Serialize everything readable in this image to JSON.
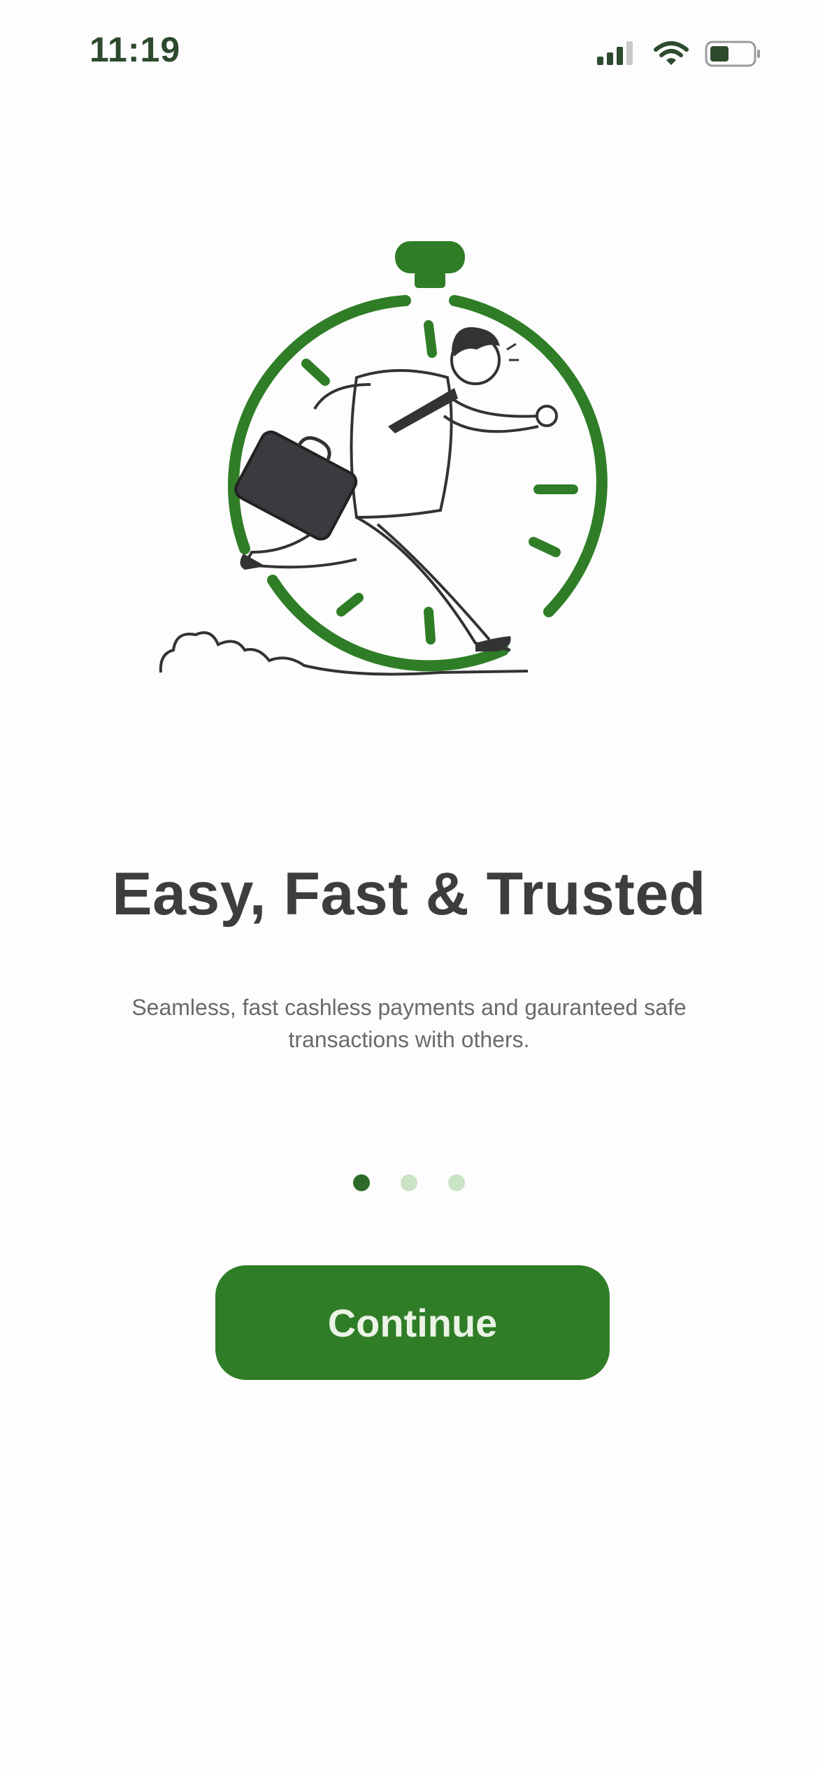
{
  "status_bar": {
    "time": "11:19",
    "icons": [
      "cellular-signal-icon",
      "wifi-icon",
      "battery-icon"
    ]
  },
  "illustration": {
    "subject": "running-man-stopwatch-illustration"
  },
  "onboarding": {
    "title": "Easy, Fast & Trusted",
    "description": "Seamless, fast cashless payments and gauranteed safe transactions with others."
  },
  "pager": {
    "total": 3,
    "active_index": 0
  },
  "actions": {
    "continue_label": "Continue"
  },
  "colors": {
    "accent": "#2f7d27",
    "dot_active": "#2e6a2a",
    "dot_inactive": "#c9e3c4",
    "title": "#3d3d3d",
    "body": "#6a6a6a"
  }
}
